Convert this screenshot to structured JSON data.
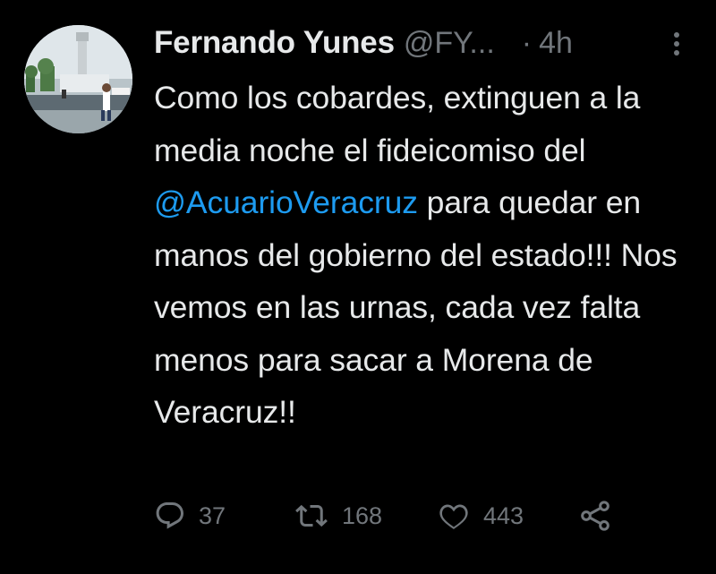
{
  "tweet": {
    "author": {
      "display_name": "Fernando Yunes",
      "handle": "@FY...",
      "avatar_icon": "profile-photo"
    },
    "separator": "·",
    "time": "4h",
    "more_icon": "more-vertical-icon",
    "text": {
      "part1": "Como los cobardes, extinguen a la media noche el fideicomiso del ",
      "mention": "@AcuarioVeracruz",
      "part2": " para quedar en manos del gobierno del estado!!! Nos vemos en las urnas, cada vez falta menos para sacar a Morena de Veracruz!!"
    },
    "actions": {
      "reply_count": "37",
      "retweet_count": "168",
      "like_count": "443"
    },
    "colors": {
      "background": "#000000",
      "text": "#e7e9ea",
      "secondary": "#71767b",
      "mention": "#1d9bf0"
    }
  }
}
